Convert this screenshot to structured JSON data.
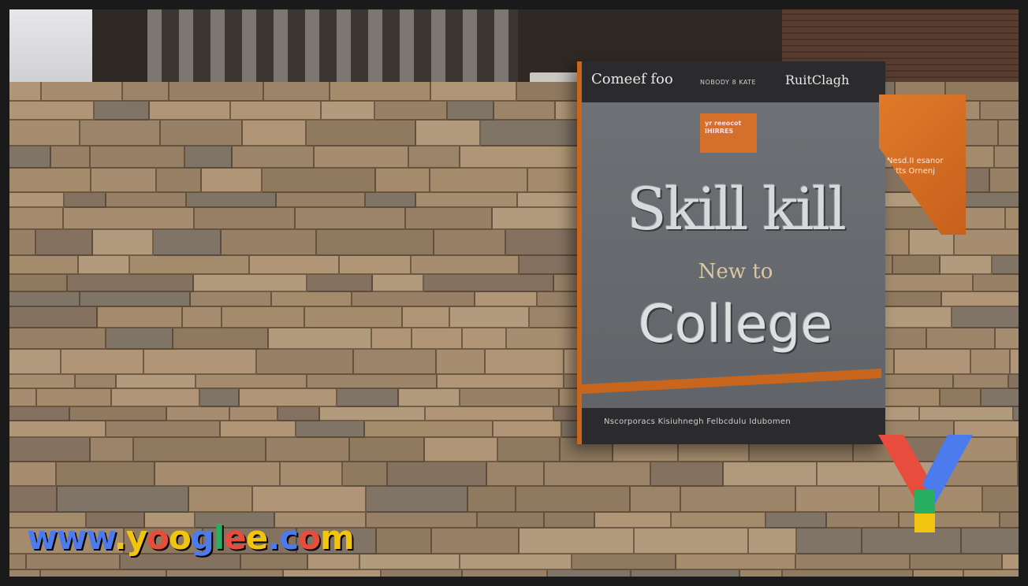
{
  "sign": {
    "brand": "Comeef foo",
    "top_small": "NOBODY 8 KATE",
    "top_right": "RuitClagh",
    "badge": "yr reeocot\nIHIRRES",
    "headline": "Skill kill",
    "subline": "New to",
    "college": "College",
    "footer": "Nscorporacs Kisiuhnegh Felbcdulu Idubomen"
  },
  "side_panel": {
    "text": "Nesd.II esanor\nsotts Ornenj"
  },
  "watermark": {
    "url_parts": [
      {
        "text": "www",
        "color": "#4b7bec"
      },
      {
        "text": ".",
        "color": "#f1c40f"
      },
      {
        "text": "y",
        "color": "#f1c40f"
      },
      {
        "text": "o",
        "color": "#e74c3c"
      },
      {
        "text": "o",
        "color": "#f1c40f"
      },
      {
        "text": "g",
        "color": "#4b7bec"
      },
      {
        "text": "l",
        "color": "#27ae60"
      },
      {
        "text": "e",
        "color": "#e74c3c"
      },
      {
        "text": "e",
        "color": "#f1c40f"
      },
      {
        "text": ".",
        "color": "#4b7bec"
      },
      {
        "text": "c",
        "color": "#4b7bec"
      },
      {
        "text": "o",
        "color": "#e74c3c"
      },
      {
        "text": "m",
        "color": "#f1c40f"
      }
    ],
    "logo": "yooglee-y-logo",
    "logo_colors": [
      "#e74c3c",
      "#4b7bec",
      "#27ae60",
      "#f1c40f"
    ]
  },
  "colors": {
    "accent_orange": "#c9661d",
    "sign_panel": "#6f7276",
    "stone": "#9d8568"
  }
}
